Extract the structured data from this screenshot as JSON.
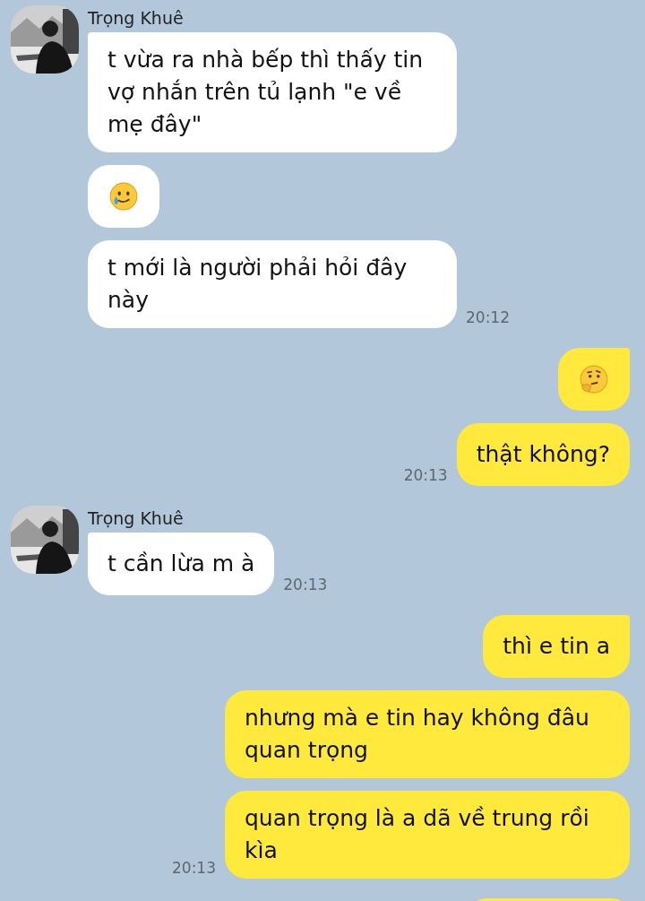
{
  "groups": [
    {
      "kind": "incoming",
      "sender": "Trọng Khuê",
      "time": "20:12",
      "messages": [
        {
          "kind": "text",
          "text": "t vừa ra nhà bếp thì thấy tin vợ nhắn trên tủ lạnh \"e về mẹ đây\""
        },
        {
          "kind": "tearful"
        },
        {
          "kind": "text",
          "text": "t mới là người phải hỏi đây này"
        }
      ]
    },
    {
      "kind": "outgoing",
      "time": "20:13",
      "messages": [
        {
          "kind": "thinking"
        },
        {
          "kind": "text",
          "text": "thật không?"
        }
      ]
    },
    {
      "kind": "incoming",
      "sender": "Trọng Khuê",
      "time": "20:13",
      "messages": [
        {
          "kind": "text",
          "text": "t cần lừa m à"
        }
      ]
    },
    {
      "kind": "outgoing",
      "time": "20:13",
      "messages": [
        {
          "kind": "text",
          "text": "thì e tin a"
        },
        {
          "kind": "text",
          "text": "nhưng mà e tin hay không đâu quan trọng"
        },
        {
          "kind": "text",
          "text": "quan trọng là a dã về trung rồi kìa"
        }
      ]
    },
    {
      "kind": "outgoing",
      "messages": [
        {
          "kind": "clipped"
        }
      ]
    }
  ]
}
